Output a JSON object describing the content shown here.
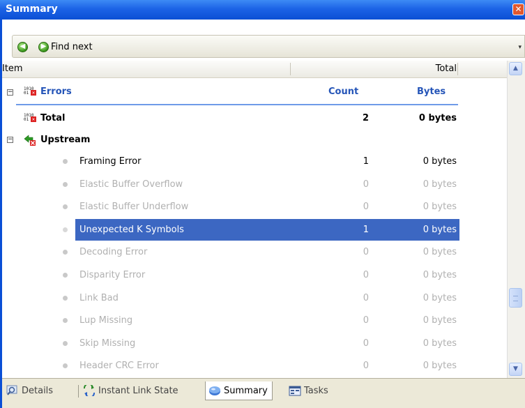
{
  "window": {
    "title": "Summary",
    "close_glyph": "✕"
  },
  "toolbar": {
    "back_icon": "green-circle-arrow-left-icon",
    "find_next_label": "Find next",
    "grip_glyph": "▾"
  },
  "header": {
    "item_label": "Item",
    "total_label": "Total"
  },
  "group_header": {
    "label": "Errors",
    "count_label": "Count",
    "bytes_label": "Bytes",
    "expander": "−",
    "bin_top": "1010",
    "bin_bottom": "01",
    "x": "✕"
  },
  "total_row": {
    "label": "Total",
    "count": "2",
    "bytes": "0 bytes",
    "bin_top": "1010",
    "bin_bottom": "01",
    "x": "✕"
  },
  "upstream": {
    "label": "Upstream",
    "expander": "−"
  },
  "rows": [
    {
      "label": "Framing Error",
      "count": "1",
      "bytes": "0 bytes",
      "dim": false,
      "selected": false
    },
    {
      "label": "Elastic Buffer Overflow",
      "count": "0",
      "bytes": "0 bytes",
      "dim": true,
      "selected": false
    },
    {
      "label": "Elastic Buffer Underflow",
      "count": "0",
      "bytes": "0 bytes",
      "dim": true,
      "selected": false
    },
    {
      "label": "Unexpected K Symbols",
      "count": "1",
      "bytes": "0 bytes",
      "dim": false,
      "selected": true
    },
    {
      "label": "Decoding Error",
      "count": "0",
      "bytes": "0 bytes",
      "dim": true,
      "selected": false
    },
    {
      "label": "Disparity Error",
      "count": "0",
      "bytes": "0 bytes",
      "dim": true,
      "selected": false
    },
    {
      "label": "Link Bad",
      "count": "0",
      "bytes": "0 bytes",
      "dim": true,
      "selected": false
    },
    {
      "label": "Lup Missing",
      "count": "0",
      "bytes": "0 bytes",
      "dim": true,
      "selected": false
    },
    {
      "label": "Skip Missing",
      "count": "0",
      "bytes": "0 bytes",
      "dim": true,
      "selected": false
    },
    {
      "label": "Header CRC Error",
      "count": "0",
      "bytes": "0 bytes",
      "dim": true,
      "selected": false
    }
  ],
  "scrollbar": {
    "up_glyph": "▲",
    "down_glyph": "▼"
  },
  "tabs": [
    {
      "label": "Details",
      "icon": "magnifier-icon",
      "active": false
    },
    {
      "label": "Instant Link State",
      "icon": "link-state-icon",
      "active": false
    },
    {
      "label": "Summary",
      "icon": "summary-disc-icon",
      "active": true
    },
    {
      "label": "Tasks",
      "icon": "tasks-icon",
      "active": false
    }
  ],
  "colors": {
    "titlebar": "#0b4fd4",
    "selection": "#3c67c2",
    "accent_text": "#2555b8",
    "dim_text": "#b0b0b0"
  }
}
